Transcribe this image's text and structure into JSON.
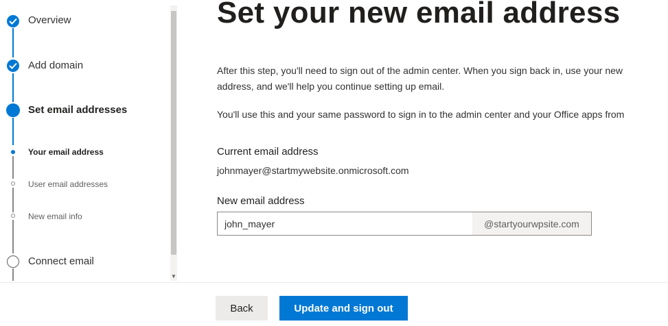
{
  "wizard": {
    "steps": [
      {
        "label": "Overview",
        "state": "complete",
        "icon": "check-icon"
      },
      {
        "label": "Add domain",
        "state": "complete",
        "icon": "check-icon"
      },
      {
        "label": "Set email addresses",
        "state": "current",
        "icon": "filled-circle-icon"
      },
      {
        "label": "Connect email",
        "state": "not-started",
        "icon": "empty-circle-icon"
      }
    ],
    "substeps": [
      {
        "label": "Your email address",
        "state": "current"
      },
      {
        "label": "User email addresses",
        "state": "not-started"
      },
      {
        "label": "New email info",
        "state": "not-started"
      }
    ]
  },
  "main": {
    "title": "Set your new email address",
    "paragraph1_line1": "After this step, you'll need to sign out of the admin center. When you sign back in, use your new",
    "paragraph1_line2": "address, and we'll help you continue setting up email.",
    "paragraph2": "You'll use this and your same password to sign in to the admin center and your Office apps from",
    "current_email_label": "Current email address",
    "current_email_value": "johnmayer@startmywebsite.onmicrosoft.com",
    "new_email_label": "New email address",
    "new_email_value": "john_mayer",
    "domain_suffix": "@startyourwpsite.com"
  },
  "footer": {
    "back_label": "Back",
    "primary_label": "Update and sign out"
  },
  "colors": {
    "accent": "#0078d4",
    "text": "#323130",
    "secondary_button": "#edebe9"
  }
}
